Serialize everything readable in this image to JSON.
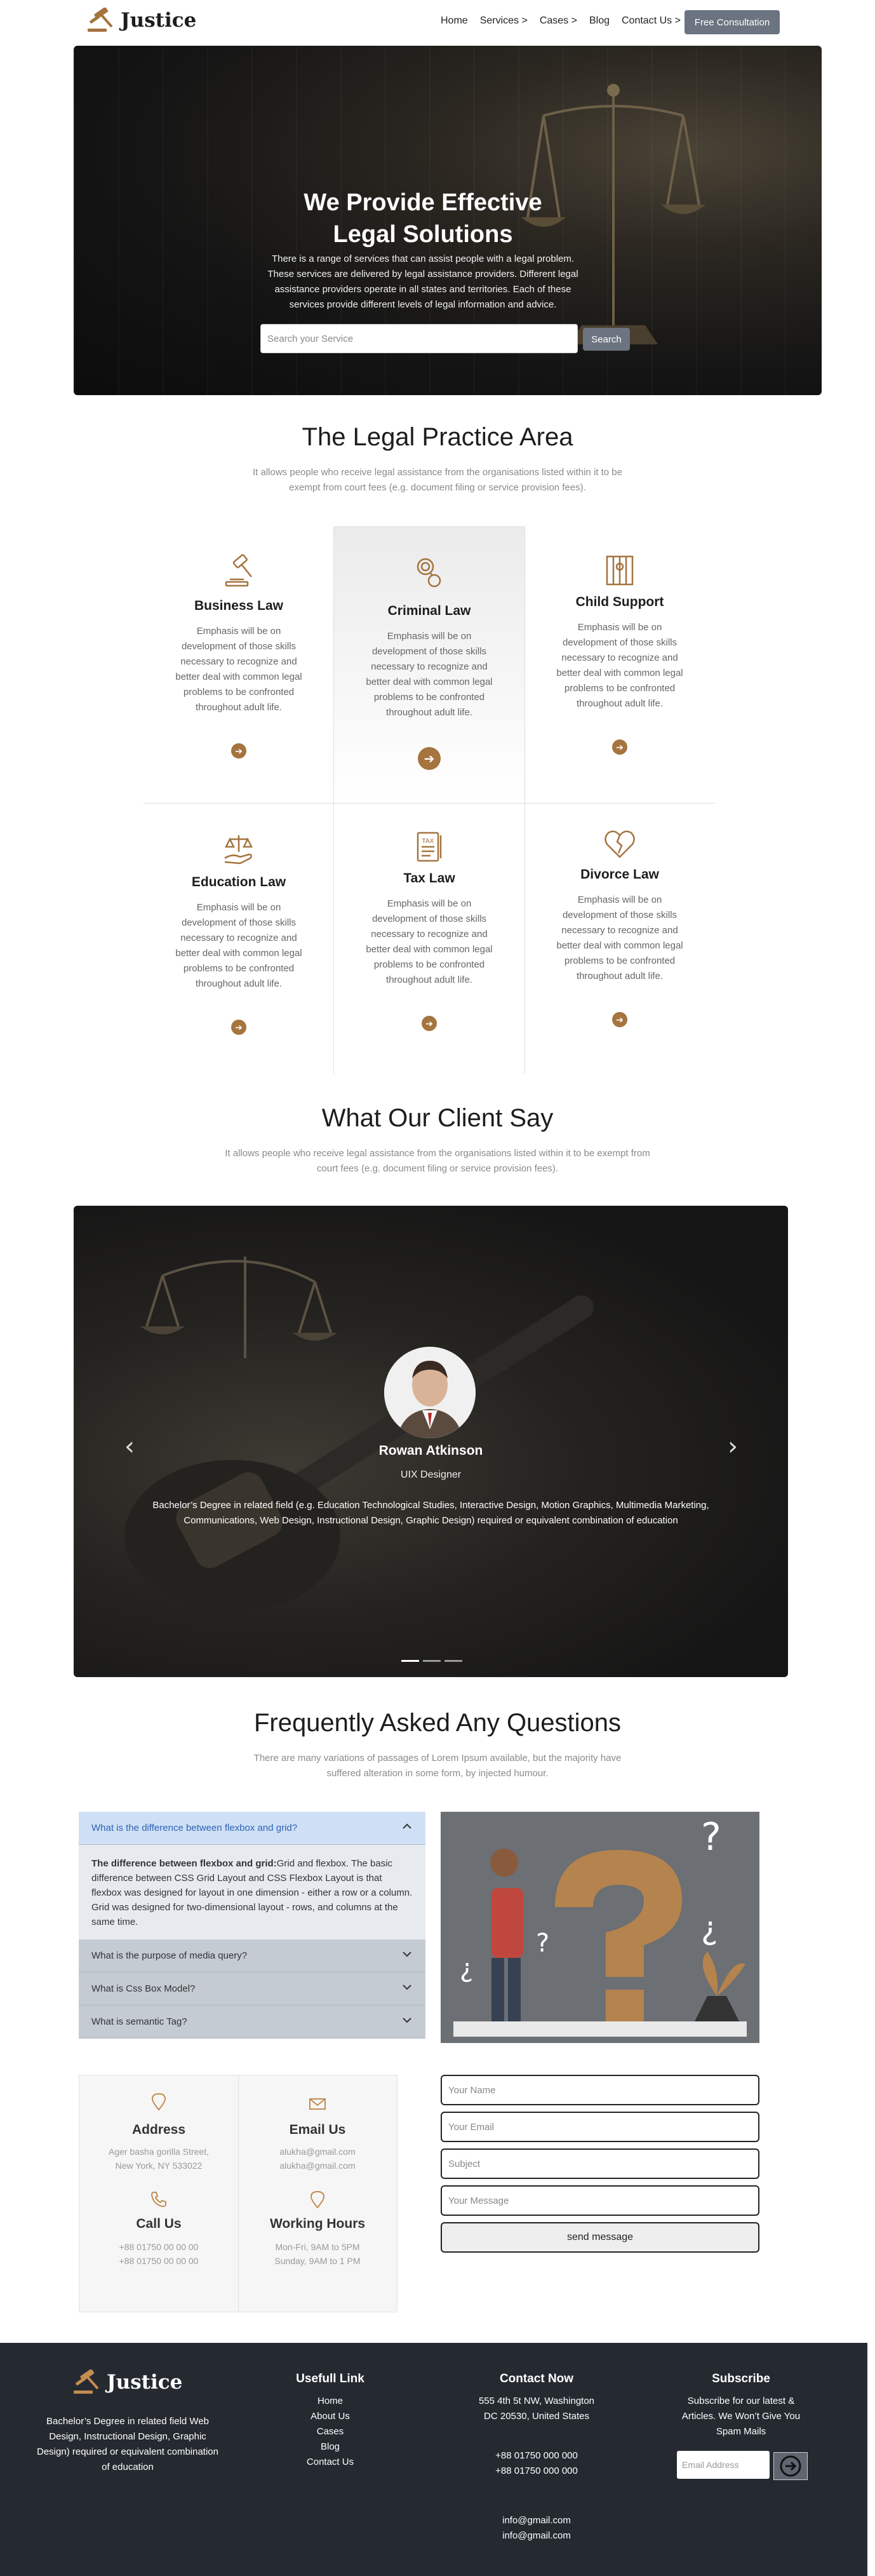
{
  "nav": {
    "brand": "Justice",
    "links": [
      "Home",
      "Services >",
      "Cases >",
      "Blog",
      "Contact Us >"
    ],
    "cta": "Free Consultation"
  },
  "hero": {
    "title_line1": "We Provide Effective",
    "title_line2": "Legal Solutions",
    "description": "There is a range of services that can assist people with a legal problem. These services are delivered by legal assistance providers. Different legal assistance providers operate in all states and territories. Each of these services provide different levels of legal information and advice.",
    "search_placeholder": "Search your Service",
    "search_button": "Search"
  },
  "practice": {
    "title": "The Legal Practice Area",
    "subtitle": "It allows people who receive legal assistance from the organisations listed within it to be exempt from court fees (e.g. document filing or service provision fees).",
    "cards": [
      {
        "title": "Business Law",
        "icon": "gavel-icon",
        "text": "Emphasis will be on development of those skills necessary to recognize and better deal with common legal problems to be confronted throughout adult life."
      },
      {
        "title": "Criminal Law",
        "icon": "handcuffs-icon",
        "text": "Emphasis will be on development of those skills necessary to recognize and better deal with common legal problems to be confronted throughout adult life."
      },
      {
        "title": "Child Support",
        "icon": "prison-icon",
        "text": "Emphasis will be on development of those skills necessary to recognize and better deal with common legal problems to be confronted throughout adult life."
      },
      {
        "title": "Education Law",
        "icon": "hand-scale-icon",
        "text": "Emphasis will be on development of those skills necessary to recognize and better deal with common legal problems to be confronted throughout adult life."
      },
      {
        "title": "Tax Law",
        "icon": "tax-document-icon",
        "text": "Emphasis will be on development of those skills necessary to recognize and better deal with common legal problems to be confronted throughout adult life."
      },
      {
        "title": "Divorce Law",
        "icon": "broken-heart-icon",
        "text": "Emphasis will be on development of those skills necessary to recognize and better deal with common legal problems to be confronted throughout adult life."
      }
    ]
  },
  "testimonials": {
    "title": "What Our Client Say",
    "subtitle": "It allows people who receive legal assistance from the organisations listed within it to be exempt from court fees (e.g. document filing or service provision fees).",
    "name": "Rowan Atkinson",
    "role": "UIX Designer",
    "quote": "Bachelor’s Degree in related field (e.g. Education Technological Studies, Interactive Design, Motion Graphics, Multimedia Marketing, Communications, Web Design, Instructional Design, Graphic Design) required or equivalent combination of education",
    "prev_icon": "chevron-left-icon",
    "next_icon": "chevron-right-icon"
  },
  "faq": {
    "title": "Frequently Asked Any Questions",
    "subtitle": "There are many variations of passages of Lorem Ipsum available, but the majority have suffered alteration in some form, by injected humour.",
    "open_question": "What is the difference between flexbox and grid?",
    "answer_bold": "The difference between flexbox and grid:",
    "answer_rest": "Grid and flexbox. The basic difference between CSS Grid Layout and CSS Flexbox Layout is that flexbox was designed for layout in one dimension - either a row or a column. Grid was designed for two-dimensional layout - rows, and columns at the same time.",
    "questions": [
      "What is the purpose of media query?",
      "What is Css Box Model?",
      "What is semantic Tag?"
    ]
  },
  "contact": {
    "address_title": "Address",
    "address_lines": [
      "Ager basha gorilla Street,",
      "New York, NY 533022"
    ],
    "email_title": "Email Us",
    "email_lines": [
      "alukha@gmail.com",
      "alukha@gmail.com"
    ],
    "call_title": "Call Us",
    "call_lines": [
      "+88 01750 00 00 00",
      "+88 01750 00 00 00"
    ],
    "hours_title": "Working Hours",
    "hours_lines": [
      "Mon-Fri, 9AM to 5PM",
      "Sunday, 9AM to 1 PM"
    ],
    "form": {
      "name_placeholder": "Your Name",
      "email_placeholder": "Your Email",
      "subject_placeholder": "Subject",
      "message_placeholder": "Your Message",
      "send": "send message"
    }
  },
  "footer": {
    "brand": "Justice",
    "about": "Bachelor’s Degree in related field Web Design, Instructional Design, Graphic Design) required or equivalent combination of education",
    "links_title": "Usefull Link",
    "links": [
      "Home",
      "About Us",
      "Cases",
      "Blog",
      "Contact Us"
    ],
    "contact_title": "Contact Now",
    "contact_address": [
      "555 4th 5t NW, Washington",
      "DC 20530, United States"
    ],
    "contact_phones": [
      "+88 01750 000 000",
      "+88 01750 000 000"
    ],
    "contact_emails": [
      "info@gmail.com",
      "info@gmail.com"
    ],
    "subscribe_title": "Subscribe",
    "subscribe_text": "Subscribe for our latest & Articles. We Won’t Give You Spam Mails",
    "subscribe_placeholder": "Email Address"
  },
  "colors": {
    "accent": "#a5743f",
    "button_gray": "#6b7480",
    "footer_bg": "#252a31",
    "faq_open": "#2e62b8"
  }
}
